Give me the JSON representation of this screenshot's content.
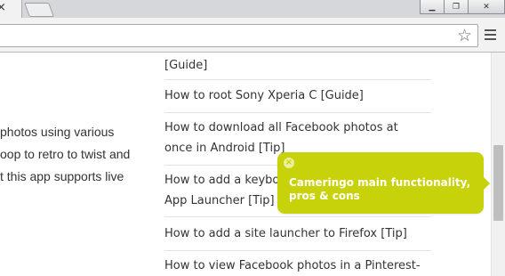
{
  "browser": {
    "tab_close_glyph": "×",
    "window_buttons": {
      "minimize_glyph": "▁",
      "restore_glyph": "❐",
      "close_glyph": "✕"
    },
    "star_glyph": "☆",
    "icons": [
      "close-icon",
      "minimize-icon",
      "restore-icon",
      "star-icon",
      "hamburger-menu-icon"
    ]
  },
  "article": {
    "lines": [
      "photos using various",
      "oop to retro to twist and",
      "t this app supports live"
    ]
  },
  "sidebar": {
    "items": [
      {
        "lines": [
          "[Guide]"
        ]
      },
      {
        "lines": [
          "How to root Sony Xperia C [Guide]"
        ]
      },
      {
        "lines": [
          "How to download all Facebook photos at",
          "once in Android [Tip]"
        ]
      },
      {
        "lines": [
          "How to add a keybo",
          "App Launcher [Tip]"
        ]
      },
      {
        "lines": [
          "How to add a site launcher to Firefox [Tip]"
        ]
      },
      {
        "lines": [
          "How to view Facebook photos in a Pinterest-"
        ]
      }
    ]
  },
  "tooltip": {
    "close_glyph": "×",
    "text_line1": "Cameringo main functionality,",
    "text_line2": "pros & cons",
    "color": "#c8d20a"
  }
}
